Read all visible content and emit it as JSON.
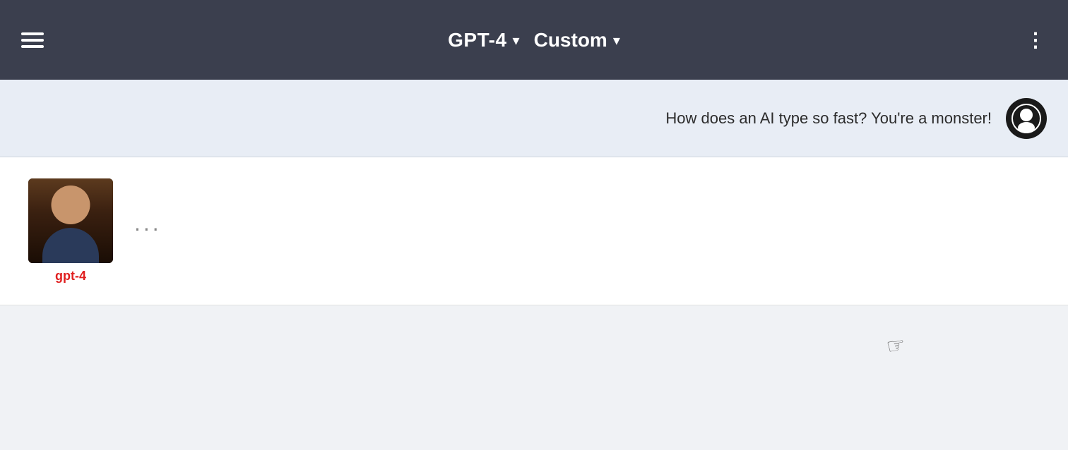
{
  "header": {
    "burger_label": "menu",
    "model": {
      "label": "GPT-4",
      "chevron": "▾"
    },
    "mode": {
      "label": "Custom",
      "chevron": "▾"
    },
    "more_options": "⋮"
  },
  "user_message": {
    "text": "How does an AI type so fast? You're a monster!"
  },
  "ai_response": {
    "name": "gpt-4",
    "typing_indicator": "..."
  },
  "bottom_bar": {}
}
